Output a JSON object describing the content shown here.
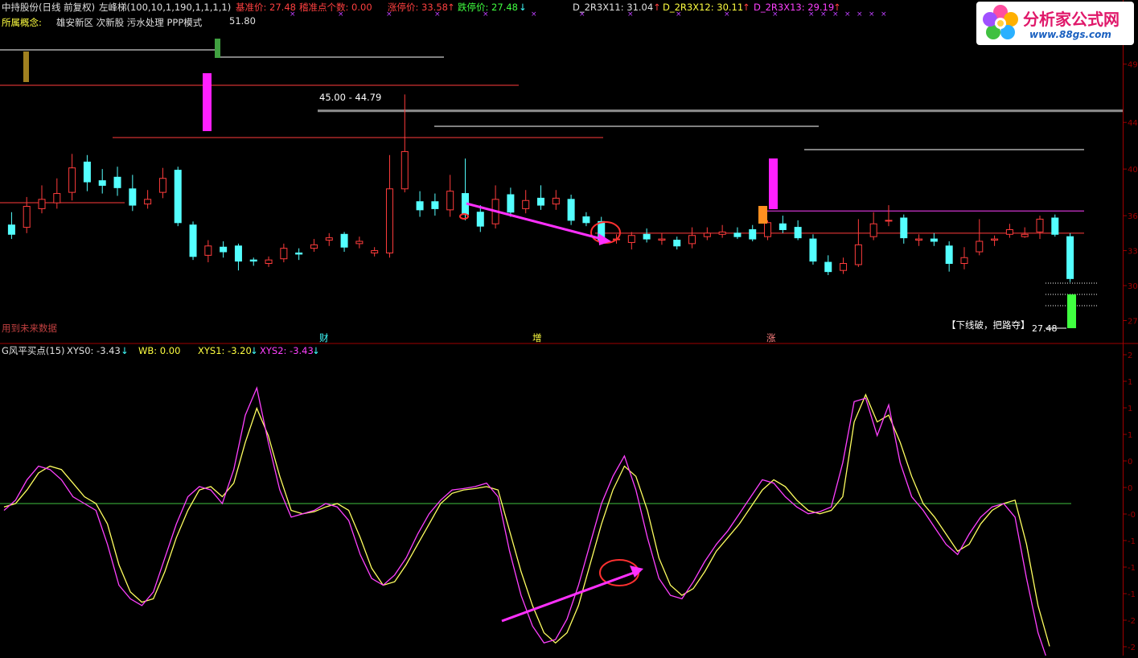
{
  "header": {
    "stock": "中持股份(日线 前复权)",
    "indicator": "左峰梯(100,10,1,190,1,1,1,1)",
    "base_price_label": "基准价: 27.48",
    "base_point_count": "稽准点个数: 0.00",
    "limit_up": "涨停价: 33.58",
    "limit_down": "跌停价: 27.48",
    "d11": "D_2R3X11: 31.04",
    "d12": "D_2R3X12: 30.11",
    "d13": "D_2R3X13: 29.19",
    "concept_label": "所属概念:",
    "concepts": "雄安新区 次新股 污水处理 PPP模式"
  },
  "logo": {
    "title": "分析家公式网",
    "url": "www.88gs.com"
  },
  "main_labels": {
    "peak_price": "51.80",
    "range": "45.00 - 44.79",
    "future_data": "用到未来数据",
    "break_note": "【下线破，把路夺】",
    "last_price": "27.48",
    "events": [
      "财",
      "增",
      "涨"
    ]
  },
  "lower_header": {
    "name": "G风平买点(15)",
    "xys0": "XYS0: -3.43",
    "wb": "WB: 0.00",
    "xys1": "XYS1: -3.20",
    "xys2": "XYS2: -3.43"
  },
  "colors": {
    "up": "#ff3c3c",
    "down": "#54ffff",
    "grid_red": "#a00000",
    "yellow_line": "#ffff60",
    "magenta_line": "#ff40ff",
    "zero_line": "#40c040",
    "arrow": "#ff30ff"
  },
  "chart_data": [
    {
      "type": "candlestick",
      "title": "中持股份(日线 前复权)",
      "y_ticks": [
        "49",
        "44",
        "40",
        "36",
        "33",
        "30",
        "27"
      ],
      "ylim": [
        26,
        50.5
      ],
      "candles": [
        {
          "o": 35.2,
          "c": 34.4,
          "h": 36.3,
          "l": 34.0
        },
        {
          "o": 35.0,
          "c": 36.8,
          "h": 37.6,
          "l": 34.5
        },
        {
          "o": 36.6,
          "c": 37.4,
          "h": 38.6,
          "l": 36.2
        },
        {
          "o": 37.1,
          "c": 37.9,
          "h": 39.2,
          "l": 36.6
        },
        {
          "o": 38.0,
          "c": 40.1,
          "h": 41.3,
          "l": 37.3
        },
        {
          "o": 40.6,
          "c": 38.9,
          "h": 41.2,
          "l": 38.1
        },
        {
          "o": 39.0,
          "c": 38.6,
          "h": 40.0,
          "l": 37.9
        },
        {
          "o": 39.3,
          "c": 38.4,
          "h": 40.2,
          "l": 37.7
        },
        {
          "o": 38.3,
          "c": 36.9,
          "h": 39.5,
          "l": 36.4
        },
        {
          "o": 37.0,
          "c": 37.4,
          "h": 38.2,
          "l": 36.6
        },
        {
          "o": 38.0,
          "c": 39.2,
          "h": 40.1,
          "l": 37.5
        },
        {
          "o": 39.9,
          "c": 35.4,
          "h": 40.2,
          "l": 35.1
        },
        {
          "o": 35.2,
          "c": 32.5,
          "h": 35.5,
          "l": 32.2
        },
        {
          "o": 32.6,
          "c": 33.4,
          "h": 33.9,
          "l": 32.0
        },
        {
          "o": 33.3,
          "c": 32.9,
          "h": 33.8,
          "l": 32.4
        },
        {
          "o": 33.4,
          "c": 32.1,
          "h": 33.6,
          "l": 31.3
        },
        {
          "o": 32.2,
          "c": 32.1,
          "h": 32.4,
          "l": 31.7
        },
        {
          "o": 31.9,
          "c": 32.2,
          "h": 32.5,
          "l": 31.6
        },
        {
          "o": 32.3,
          "c": 33.2,
          "h": 33.6,
          "l": 32.0
        },
        {
          "o": 32.8,
          "c": 32.7,
          "h": 33.2,
          "l": 32.2
        },
        {
          "o": 33.2,
          "c": 33.5,
          "h": 34.0,
          "l": 32.9
        },
        {
          "o": 33.9,
          "c": 34.1,
          "h": 34.5,
          "l": 33.4
        },
        {
          "o": 34.4,
          "c": 33.3,
          "h": 34.6,
          "l": 32.9
        },
        {
          "o": 33.6,
          "c": 33.8,
          "h": 34.2,
          "l": 33.2
        },
        {
          "o": 32.8,
          "c": 33.0,
          "h": 33.3,
          "l": 32.5
        },
        {
          "o": 32.8,
          "c": 38.3,
          "h": 41.2,
          "l": 32.4
        },
        {
          "o": 38.3,
          "c": 41.5,
          "h": 46.4,
          "l": 38.0
        },
        {
          "o": 37.2,
          "c": 36.5,
          "h": 38.1,
          "l": 35.9
        },
        {
          "o": 37.2,
          "c": 36.6,
          "h": 37.9,
          "l": 36.0
        },
        {
          "o": 36.5,
          "c": 38.1,
          "h": 39.5,
          "l": 35.9
        },
        {
          "o": 37.9,
          "c": 36.1,
          "h": 40.9,
          "l": 35.6
        },
        {
          "o": 36.3,
          "c": 35.1,
          "h": 36.9,
          "l": 34.6
        },
        {
          "o": 35.3,
          "c": 37.4,
          "h": 38.6,
          "l": 34.9
        },
        {
          "o": 37.8,
          "c": 36.3,
          "h": 38.4,
          "l": 35.9
        },
        {
          "o": 36.6,
          "c": 37.3,
          "h": 38.2,
          "l": 36.2
        },
        {
          "o": 37.5,
          "c": 36.9,
          "h": 38.6,
          "l": 36.5
        },
        {
          "o": 37.0,
          "c": 37.5,
          "h": 38.2,
          "l": 36.5
        },
        {
          "o": 37.4,
          "c": 35.6,
          "h": 37.8,
          "l": 35.2
        },
        {
          "o": 35.9,
          "c": 35.4,
          "h": 36.3,
          "l": 35.1
        },
        {
          "o": 35.5,
          "c": 33.9,
          "h": 35.9,
          "l": 33.6
        },
        {
          "o": 34.0,
          "c": 34.0,
          "h": 34.4,
          "l": 33.6
        },
        {
          "o": 33.7,
          "c": 34.3,
          "h": 34.6,
          "l": 33.1
        },
        {
          "o": 34.4,
          "c": 34.0,
          "h": 34.9,
          "l": 33.7
        },
        {
          "o": 33.9,
          "c": 34.0,
          "h": 34.5,
          "l": 33.5
        },
        {
          "o": 33.9,
          "c": 33.4,
          "h": 34.2,
          "l": 33.1
        },
        {
          "o": 33.6,
          "c": 34.3,
          "h": 35.0,
          "l": 33.2
        },
        {
          "o": 34.2,
          "c": 34.5,
          "h": 35.0,
          "l": 33.9
        },
        {
          "o": 34.4,
          "c": 34.6,
          "h": 35.2,
          "l": 34.1
        },
        {
          "o": 34.5,
          "c": 34.2,
          "h": 35.0,
          "l": 34.0
        },
        {
          "o": 34.8,
          "c": 34.0,
          "h": 35.2,
          "l": 33.8
        },
        {
          "o": 34.2,
          "c": 35.4,
          "h": 35.6,
          "l": 33.9
        },
        {
          "o": 35.3,
          "c": 34.8,
          "h": 36.0,
          "l": 34.5
        },
        {
          "o": 35.0,
          "c": 34.1,
          "h": 35.6,
          "l": 33.9
        },
        {
          "o": 34.0,
          "c": 32.1,
          "h": 34.4,
          "l": 31.8
        },
        {
          "o": 32.0,
          "c": 31.2,
          "h": 32.6,
          "l": 30.9
        },
        {
          "o": 31.3,
          "c": 31.9,
          "h": 32.4,
          "l": 31.0
        },
        {
          "o": 31.8,
          "c": 33.5,
          "h": 35.7,
          "l": 31.6
        },
        {
          "o": 34.2,
          "c": 35.3,
          "h": 36.3,
          "l": 33.9
        },
        {
          "o": 35.6,
          "c": 35.6,
          "h": 36.9,
          "l": 35.1
        },
        {
          "o": 35.8,
          "c": 34.1,
          "h": 36.1,
          "l": 33.6
        },
        {
          "o": 33.9,
          "c": 34.0,
          "h": 34.4,
          "l": 33.4
        },
        {
          "o": 34.0,
          "c": 33.8,
          "h": 34.5,
          "l": 33.4
        },
        {
          "o": 33.4,
          "c": 31.9,
          "h": 33.8,
          "l": 31.2
        },
        {
          "o": 31.9,
          "c": 32.4,
          "h": 33.3,
          "l": 31.4
        },
        {
          "o": 32.9,
          "c": 33.8,
          "h": 35.7,
          "l": 32.6
        },
        {
          "o": 33.9,
          "c": 34.0,
          "h": 34.3,
          "l": 33.4
        },
        {
          "o": 34.4,
          "c": 34.8,
          "h": 35.3,
          "l": 34.1
        },
        {
          "o": 34.2,
          "c": 34.4,
          "h": 35.0,
          "l": 34.1
        },
        {
          "o": 34.6,
          "c": 35.7,
          "h": 36.0,
          "l": 34.0
        },
        {
          "o": 35.8,
          "c": 34.4,
          "h": 36.1,
          "l": 34.2
        },
        {
          "o": 34.2,
          "c": 30.6,
          "h": 34.5,
          "l": 30.3
        }
      ],
      "reference_lines": [
        45.0,
        44.79,
        36.4,
        34.5,
        34.0,
        32.7,
        29.9,
        29.0
      ]
    },
    {
      "type": "line",
      "title": "G风平买点(15)",
      "y_ticks": [
        "2",
        "1",
        "1",
        "1",
        "0",
        "0",
        "-0",
        "-1",
        "-1",
        "-1",
        "-2",
        "-2",
        "-2"
      ],
      "ylim": [
        -2.2,
        2.2
      ],
      "series": [
        {
          "name": "XYS1",
          "values": [
            -0.05,
            0.0,
            0.2,
            0.45,
            0.55,
            0.5,
            0.3,
            0.1,
            0.0,
            -0.3,
            -0.9,
            -1.3,
            -1.45,
            -1.4,
            -1.0,
            -0.5,
            -0.1,
            0.2,
            0.25,
            0.1,
            0.3,
            0.9,
            1.4,
            1.0,
            0.4,
            -0.1,
            -0.15,
            -0.12,
            -0.05,
            0.0,
            -0.1,
            -0.5,
            -0.95,
            -1.2,
            -1.15,
            -0.9,
            -0.6,
            -0.3,
            0.0,
            0.15,
            0.2,
            0.22,
            0.25,
            0.2,
            -0.4,
            -1.0,
            -1.5,
            -1.9,
            -2.05,
            -1.9,
            -1.5,
            -0.9,
            -0.3,
            0.2,
            0.55,
            0.4,
            -0.1,
            -0.8,
            -1.2,
            -1.35,
            -1.25,
            -1.0,
            -0.7,
            -0.5,
            -0.3,
            -0.05,
            0.2,
            0.35,
            0.25,
            0.05,
            -0.1,
            -0.15,
            -0.1,
            0.1,
            1.2,
            1.6,
            1.2,
            1.3,
            0.9,
            0.4,
            0.0,
            -0.2,
            -0.45,
            -0.7,
            -0.6,
            -0.3,
            -0.1,
            0.0,
            0.05,
            -0.6,
            -1.5,
            -2.1
          ]
        },
        {
          "name": "XYS2",
          "values": [
            -0.1,
            0.05,
            0.35,
            0.55,
            0.5,
            0.35,
            0.1,
            0.0,
            -0.1,
            -0.6,
            -1.2,
            -1.4,
            -1.5,
            -1.3,
            -0.8,
            -0.3,
            0.1,
            0.25,
            0.2,
            0.0,
            0.5,
            1.3,
            1.7,
            0.9,
            0.2,
            -0.2,
            -0.15,
            -0.1,
            0.0,
            -0.05,
            -0.25,
            -0.75,
            -1.1,
            -1.2,
            -1.05,
            -0.8,
            -0.45,
            -0.15,
            0.05,
            0.2,
            0.22,
            0.25,
            0.3,
            0.1,
            -0.7,
            -1.35,
            -1.8,
            -2.05,
            -2.0,
            -1.7,
            -1.2,
            -0.6,
            0.0,
            0.4,
            0.7,
            0.2,
            -0.5,
            -1.1,
            -1.35,
            -1.4,
            -1.15,
            -0.85,
            -0.6,
            -0.4,
            -0.15,
            0.1,
            0.35,
            0.3,
            0.1,
            -0.05,
            -0.15,
            -0.12,
            -0.05,
            0.6,
            1.5,
            1.55,
            1.0,
            1.45,
            0.6,
            0.1,
            -0.1,
            -0.35,
            -0.6,
            -0.75,
            -0.45,
            -0.2,
            -0.05,
            0.0,
            -0.2,
            -1.1,
            -1.9,
            -2.4
          ]
        }
      ]
    }
  ]
}
